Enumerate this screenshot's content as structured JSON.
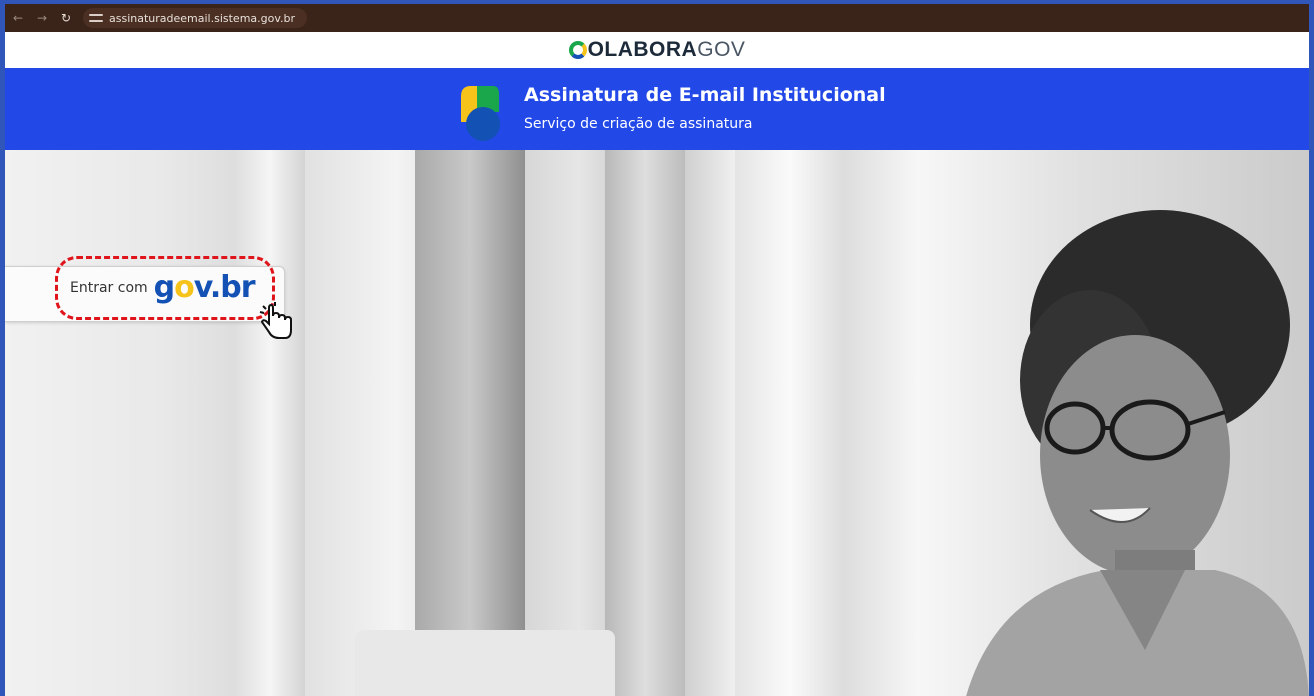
{
  "browser": {
    "back_icon": "←",
    "forward_icon": "→",
    "reload_icon": "↻",
    "url": "assinaturadeemail.sistema.gov.br"
  },
  "colabora": {
    "logo_bold": "OLABORA",
    "logo_thin": "GOV"
  },
  "banner": {
    "title": "Assinatura de E-mail Institucional",
    "subtitle": "Serviço de criação de assinatura"
  },
  "login": {
    "label": "Entrar com",
    "brand_g": "g",
    "brand_o": "o",
    "brand_v": "v",
    "brand_dot": ".",
    "brand_br": "br"
  },
  "colors": {
    "banner_blue": "#2248e8",
    "gov_blue": "#1351b4",
    "gov_yellow": "#f6c31a",
    "highlight_red": "#e0141b"
  }
}
